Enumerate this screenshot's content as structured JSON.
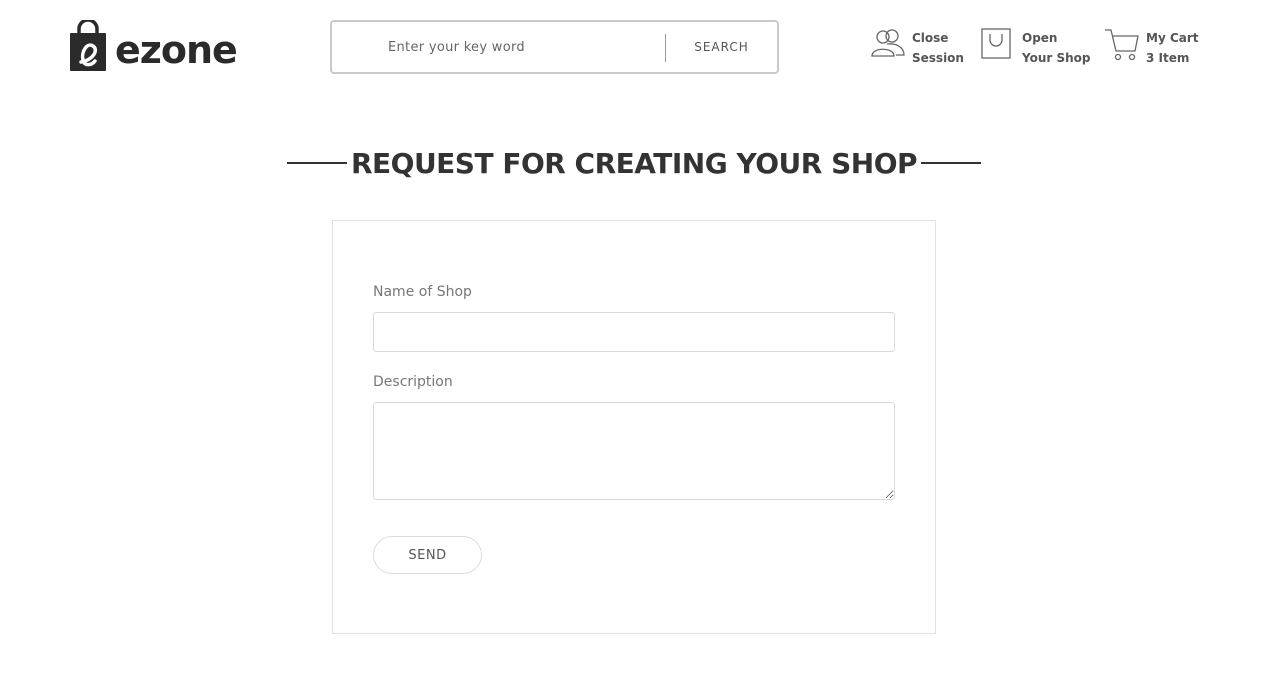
{
  "brand": {
    "name": "ezone",
    "logo_letter": "e"
  },
  "search": {
    "placeholder": "Enter your key word",
    "button_label": "SEARCH"
  },
  "header_links": {
    "session": {
      "line1": "Close",
      "line2": "Session",
      "icon": "users-icon"
    },
    "shop": {
      "line1": "Open",
      "line2": "Your Shop",
      "icon": "shopping-bag-icon"
    },
    "cart": {
      "line1": "My Cart",
      "line2": "3 Item",
      "icon": "cart-icon"
    }
  },
  "page": {
    "title": "REQUEST FOR CREATING YOUR SHOP"
  },
  "form": {
    "shop_name_label": "Name of Shop",
    "shop_name_value": "",
    "description_label": "Description",
    "description_value": "",
    "send_label": "SEND"
  },
  "colors": {
    "text_dark": "#333333",
    "text_muted": "#777777",
    "border": "#d9d9d9"
  }
}
